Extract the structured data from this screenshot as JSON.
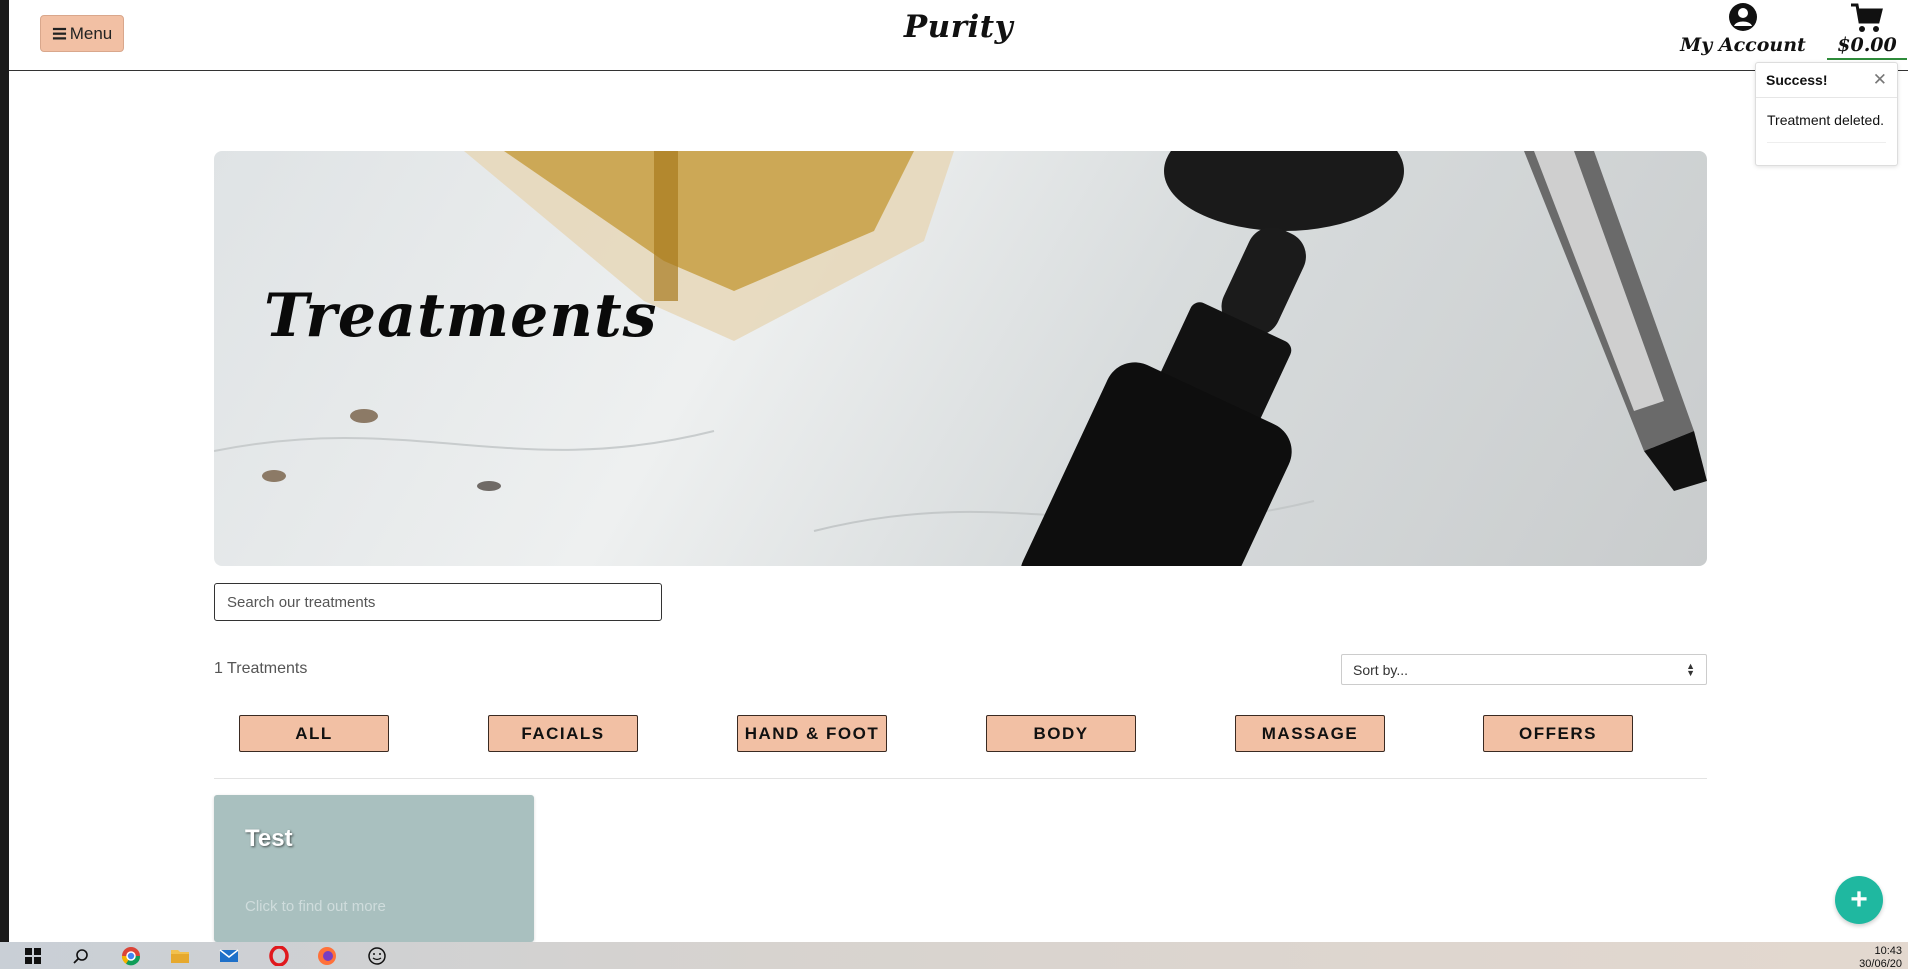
{
  "header": {
    "menu_label": "Menu",
    "brand": "Purity",
    "account_label": "My Account",
    "cart_total": "$0.00"
  },
  "toast": {
    "title": "Success!",
    "message": "Treatment deleted."
  },
  "hero": {
    "title": "Treatments"
  },
  "search": {
    "placeholder": "Search our treatments"
  },
  "results": {
    "count_label": "1 Treatments",
    "sort_label": "Sort by..."
  },
  "categories": [
    "ALL",
    "FACIALS",
    "HAND & FOOT",
    "BODY",
    "MASSAGE",
    "OFFERS"
  ],
  "cards": [
    {
      "title": "Test",
      "link": "Click to find out more"
    }
  ],
  "taskbar": {
    "time": "10:43",
    "date": "30/06/20"
  },
  "colors": {
    "accent": "#f2c0a4",
    "card": "#a9c0bf",
    "fab": "#1fb8a0"
  }
}
